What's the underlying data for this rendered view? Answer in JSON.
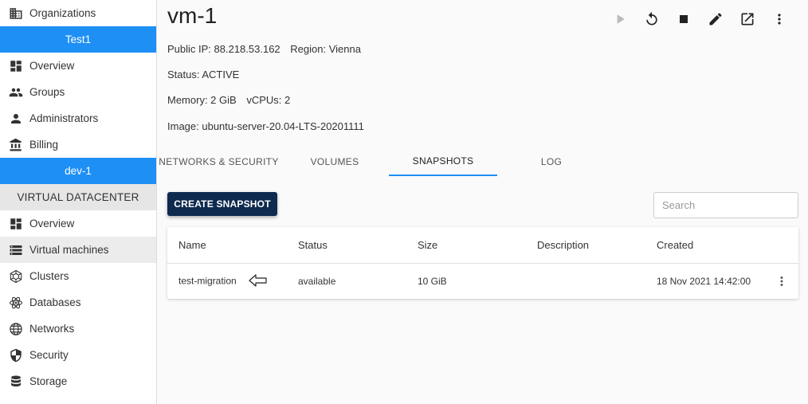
{
  "sidebar": {
    "organizations": "Organizations",
    "org_name": "Test1",
    "org_items": [
      {
        "label": "Overview",
        "icon": "dashboard-icon"
      },
      {
        "label": "Groups",
        "icon": "groups-icon"
      },
      {
        "label": "Administrators",
        "icon": "person-icon"
      },
      {
        "label": "Billing",
        "icon": "bank-icon"
      }
    ],
    "vdc_name": "dev-1",
    "section_header": "VIRTUAL DATACENTER",
    "vdc_items": [
      {
        "label": "Overview",
        "icon": "dashboard-icon"
      },
      {
        "label": "Virtual machines",
        "icon": "storage-list-icon"
      },
      {
        "label": "Clusters",
        "icon": "cluster-icon"
      },
      {
        "label": "Databases",
        "icon": "atom-icon"
      },
      {
        "label": "Networks",
        "icon": "globe-icon"
      },
      {
        "label": "Security",
        "icon": "shield-icon"
      },
      {
        "label": "Storage",
        "icon": "database-icon"
      }
    ]
  },
  "vm": {
    "name": "vm-1",
    "public_ip": "Public IP: 88.218.53.162",
    "region": "Region: Vienna",
    "status": "Status: ACTIVE",
    "memory": "Memory: 2 GiB",
    "vcpus": "vCPUs: 2",
    "image": "Image: ubuntu-server-20.04-LTS-20201111"
  },
  "tabs": [
    "NETWORKS & SECURITY",
    "VOLUMES",
    "SNAPSHOTS",
    "LOG"
  ],
  "create_button": "CREATE SNAPSHOT",
  "search_placeholder": "Search",
  "table": {
    "headers": [
      "Name",
      "Status",
      "Size",
      "Description",
      "Created"
    ],
    "rows": [
      {
        "name": "test-migration",
        "status": "available",
        "size": "10 GiB",
        "description": "",
        "created": "18 Nov 2021 14:42:00"
      }
    ]
  },
  "colors": {
    "accent_blue": "#1e8ff5",
    "navy_button": "#0e2a4f"
  }
}
